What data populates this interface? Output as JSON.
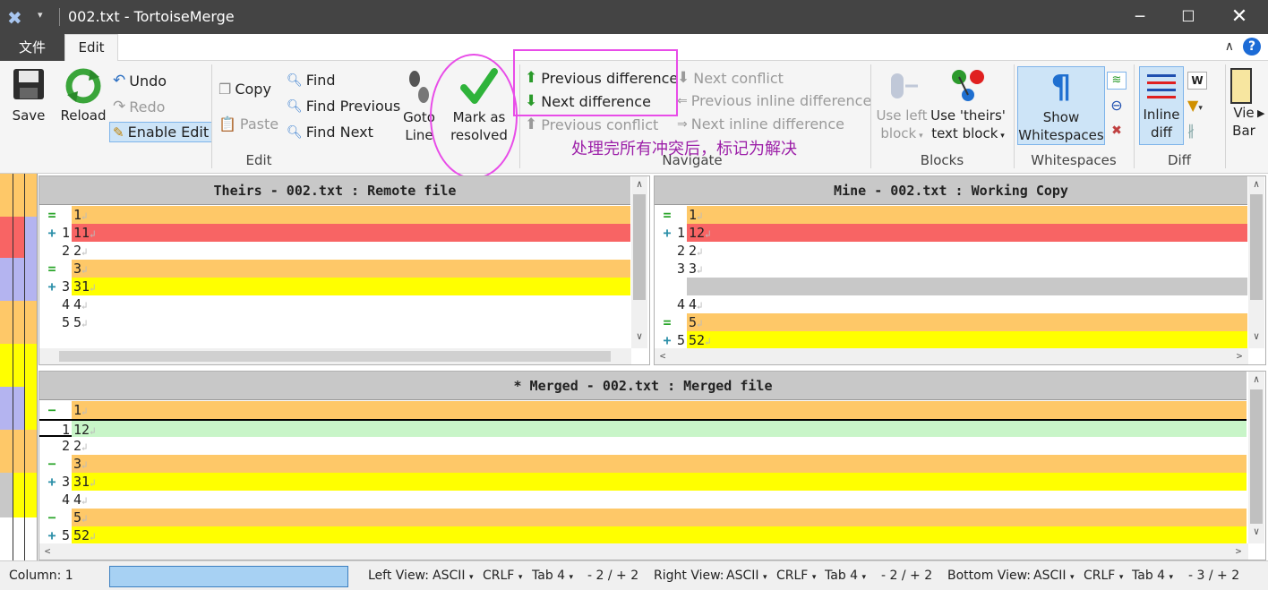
{
  "window": {
    "title": "002.txt - TortoiseMerge",
    "minimize_icon": "minimize-icon",
    "maximize_icon": "maximize-icon",
    "close_icon": "close-icon"
  },
  "menu": {
    "file": "文件",
    "edit": "Edit"
  },
  "ribbon": {
    "save": "Save",
    "reload": "Reload",
    "undo": "Undo",
    "redo": "Redo",
    "enable_edit": "Enable Edit",
    "copy": "Copy",
    "paste": "Paste",
    "find": "Find",
    "find_previous": "Find Previous",
    "find_next": "Find Next",
    "goto_line_1": "Goto",
    "goto_line_2": "Line",
    "mark_resolved_1": "Mark as",
    "mark_resolved_2": "resolved",
    "previous_difference": "Previous difference",
    "next_difference": "Next difference",
    "previous_conflict": "Previous conflict",
    "next_conflict": "Next conflict",
    "previous_inline_difference": "Previous inline difference",
    "next_inline_difference": "Next inline difference",
    "use_left_block_1": "Use left",
    "use_left_block_2": "block",
    "use_theirs_1": "Use 'theirs'",
    "use_theirs_2": "text block",
    "show_ws_1": "Show",
    "show_ws_2": "Whitespaces",
    "inline_diff_1": "Inline",
    "inline_diff_2": "diff",
    "view_bars_1": "Vie",
    "view_bars_2": "Bar",
    "groups": {
      "edit": "Edit",
      "navigate": "Navigate",
      "blocks": "Blocks",
      "whitespaces": "Whitespaces",
      "diff": "Diff"
    }
  },
  "annotation": "处理完所有冲突后，标记为解决",
  "theirs": {
    "header": "Theirs - 002.txt : Remote file",
    "lines": [
      {
        "marker": "=",
        "num": "",
        "text": "1",
        "bg": "#fec868"
      },
      {
        "marker": "+",
        "num": "1",
        "text": "11",
        "bg": "#f86464"
      },
      {
        "marker": "",
        "num": "2",
        "text": "2",
        "bg": "#ffffff"
      },
      {
        "marker": "=",
        "num": "",
        "text": "3",
        "bg": "#fec868"
      },
      {
        "marker": "+",
        "num": "3",
        "text": "31",
        "bg": "#ffff00"
      },
      {
        "marker": "",
        "num": "4",
        "text": "4",
        "bg": "#ffffff"
      },
      {
        "marker": "",
        "num": "5",
        "text": "5",
        "bg": "#ffffff"
      }
    ]
  },
  "mine": {
    "header": "Mine - 002.txt : Working Copy",
    "lines": [
      {
        "marker": "=",
        "num": "",
        "text": "1",
        "bg": "#fec868"
      },
      {
        "marker": "+",
        "num": "1",
        "text": "12",
        "bg": "#f86464"
      },
      {
        "marker": "",
        "num": "2",
        "text": "2",
        "bg": "#ffffff"
      },
      {
        "marker": "",
        "num": "3",
        "text": "3",
        "bg": "#ffffff"
      },
      {
        "marker": "",
        "num": "",
        "text": "",
        "bg": "#c8c8c8"
      },
      {
        "marker": "",
        "num": "4",
        "text": "4",
        "bg": "#ffffff"
      },
      {
        "marker": "=",
        "num": "",
        "text": "5",
        "bg": "#fec868"
      },
      {
        "marker": "+",
        "num": "5",
        "text": "52",
        "bg": "#ffff00"
      }
    ]
  },
  "merged": {
    "header": "* Merged - 002.txt : Merged file",
    "lines": [
      {
        "marker": "−",
        "num": "",
        "text": "1",
        "bg": "#fec868"
      },
      {
        "marker": "",
        "num": "1",
        "text": "12",
        "bg": "#c8f5c8"
      },
      {
        "marker": "",
        "num": "2",
        "text": "2",
        "bg": "#ffffff"
      },
      {
        "marker": "−",
        "num": "",
        "text": "3",
        "bg": "#fec868"
      },
      {
        "marker": "+",
        "num": "3",
        "text": "31",
        "bg": "#ffff00"
      },
      {
        "marker": "",
        "num": "4",
        "text": "4",
        "bg": "#ffffff"
      },
      {
        "marker": "−",
        "num": "",
        "text": "5",
        "bg": "#fec868"
      },
      {
        "marker": "+",
        "num": "5",
        "text": "52",
        "bg": "#ffff00"
      }
    ]
  },
  "status": {
    "column": "Column: 1",
    "left_view": "Left View:",
    "right_view": "Right View:",
    "bottom_view": "Bottom View:",
    "encoding": "ASCII",
    "eol": "CRLF",
    "tab": "Tab 4",
    "left_counts": "- 2 / + 2",
    "right_counts": "- 2 / + 2",
    "bottom_counts": "- 3 / + 2"
  },
  "colors": {
    "conflict_orange": "#fec868",
    "removed_red": "#f86464",
    "added_yellow": "#ffff00",
    "accent_magenta": "#e84ce8"
  }
}
